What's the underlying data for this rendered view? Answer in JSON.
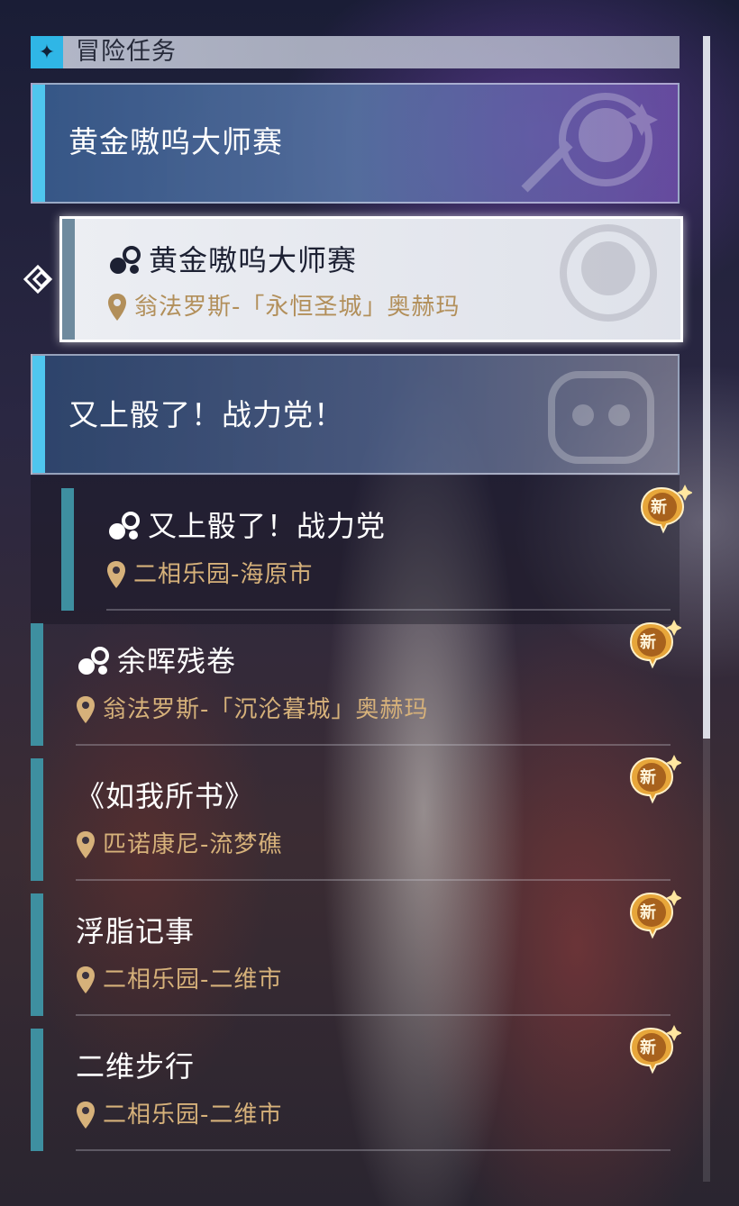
{
  "header": {
    "icon": "✦",
    "title": "冒险任务"
  },
  "categories": [
    {
      "title": "黄金嗷呜大师赛"
    },
    {
      "title": "又上骰了！战力党！"
    }
  ],
  "quests": [
    {
      "title": "黄金嗷呜大师赛",
      "location": "翁法罗斯-「永恒圣城」奥赫玛",
      "selected": true,
      "new": false,
      "type_icon": "quest-type-icon"
    },
    {
      "title": "又上骰了！战力党",
      "location": "二相乐园-海原市",
      "selected": false,
      "new": true,
      "type_icon": "quest-type-icon"
    },
    {
      "title": "余晖残卷",
      "location": "翁法罗斯-「沉沦暮城」奥赫玛",
      "selected": false,
      "new": true,
      "type_icon": "quest-type-icon"
    },
    {
      "title": "《如我所书》",
      "location": "匹诺康尼-流梦礁",
      "selected": false,
      "new": true
    },
    {
      "title": "浮脂记事",
      "location": "二相乐园-二维市",
      "selected": false,
      "new": true
    },
    {
      "title": "二维步行",
      "location": "二相乐园-二维市",
      "selected": false,
      "new": true
    }
  ],
  "badge_label": "新",
  "colors": {
    "accent_cyan": "#4fc6ee",
    "accent_teal": "#3e8fa0",
    "location_gold": "#d6b17a",
    "badge_gold": "#e7a63a"
  }
}
